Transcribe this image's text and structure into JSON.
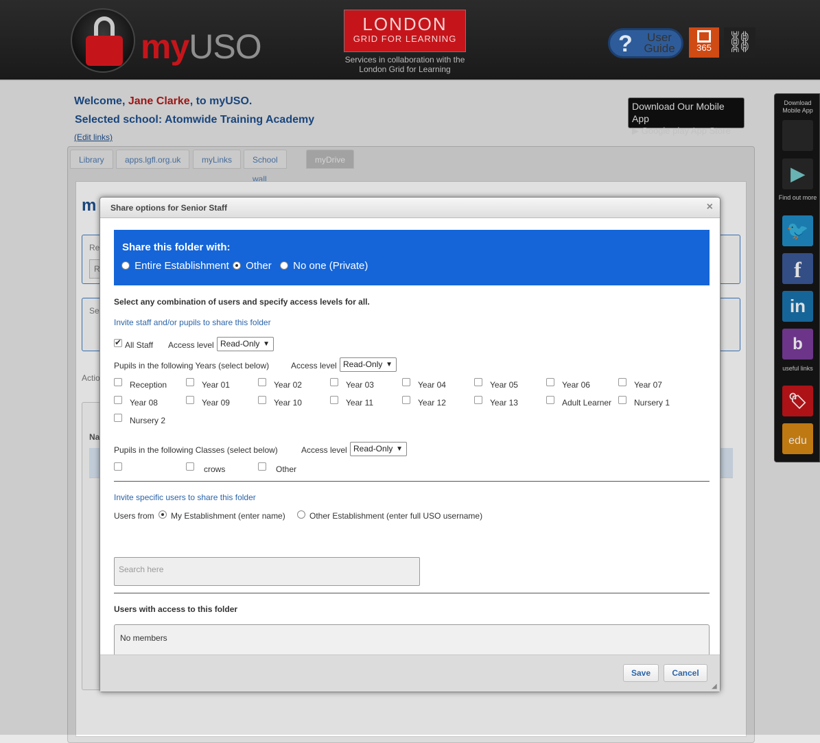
{
  "header": {
    "logo_my": "my",
    "logo_uso": "USO",
    "lgfl_line1": "LONDON",
    "lgfl_line2": "GRID FOR LEARNING",
    "lgfl_caption_1": "Services in collaboration with the",
    "lgfl_caption_2": "London Grid for Learning",
    "user_guide_line1": "User",
    "user_guide_line2": "Guide",
    "office_label": "365"
  },
  "welcome": {
    "prefix": "Welcome, ",
    "name": "Jane Clarke",
    "suffix": ", to myUSO.",
    "school": "Selected school: Atomwide Training Academy",
    "edit_links": "(Edit links)"
  },
  "mobile_app": {
    "line1": "Download Our Mobile App",
    "line2": "▶ Google play   App Store"
  },
  "tabs": [
    "Library",
    "apps.lgfl.org.uk",
    "myLinks",
    "School wall",
    "myDrive"
  ],
  "background": {
    "title_fragment": "m",
    "re_fragment": "Re",
    "r_fragment": "R",
    "se_fragment": "Se",
    "actio_fragment": "Actio",
    "na_fragment": "Na"
  },
  "sidebar": {
    "download_caption": "Download Mobile App",
    "find_out_caption": "Find out more",
    "useful_links_caption": "useful links",
    "edu_label": "edu",
    "in_label": "in"
  },
  "modal": {
    "title": "Share options for Senior Staff",
    "close": "×",
    "share_heading": "Share this folder with:",
    "share_options": [
      "Entire Establishment",
      "Other",
      "No one (Private)"
    ],
    "share_selected": "Other",
    "instruction": "Select any combination of users and specify access levels for all.",
    "invite_staff_link": "Invite staff and/or pupils to share this folder",
    "all_staff_label": "All Staff",
    "access_level_label": "Access level",
    "access_level_value": "Read-Only",
    "years_label": "Pupils in the following Years (select below)",
    "years": [
      "Reception",
      "Year 01",
      "Year 02",
      "Year 03",
      "Year 04",
      "Year 05",
      "Year 06",
      "Year 07",
      "Year 08",
      "Year 09",
      "Year 10",
      "Year 11",
      "Year 12",
      "Year 13",
      "Adult Learner",
      "Nursery 1",
      "Nursery 2"
    ],
    "classes_label": "Pupils in the following Classes (select below)",
    "classes": [
      "",
      "crows",
      "Other"
    ],
    "invite_specific_link": "Invite specific users to share this folder",
    "users_from_label": "Users from",
    "users_from_options": [
      "My Establishment (enter name)",
      "Other Establishment (enter full USO username)"
    ],
    "users_from_selected": "My Establishment (enter name)",
    "search_placeholder": "Search here",
    "access_heading": "Users with access to this folder",
    "members_text": "No members",
    "save_label": "Save",
    "cancel_label": "Cancel"
  },
  "colors": {
    "brand_red": "#c5151b",
    "share_panel_blue": "#1565d8",
    "link_blue": "#2b64a8"
  }
}
